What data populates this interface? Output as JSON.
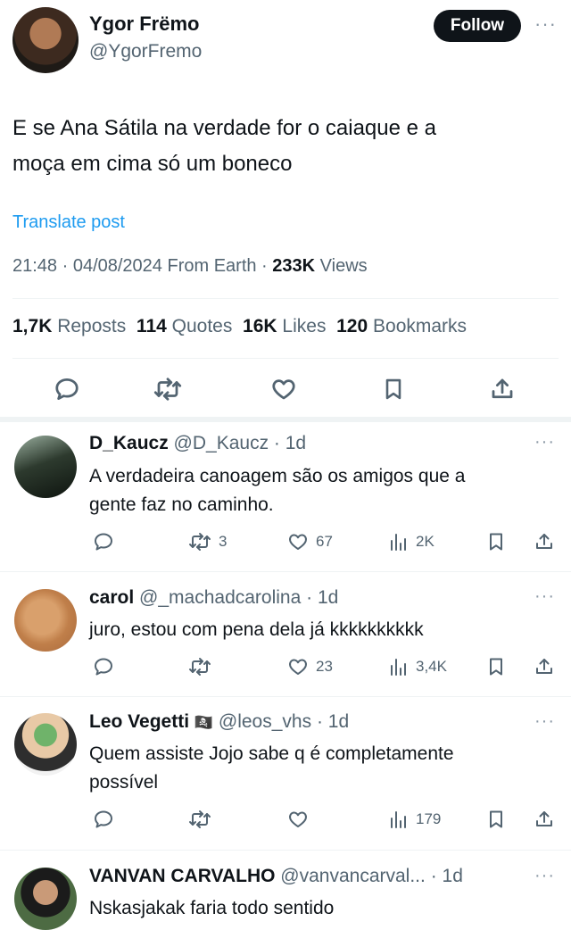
{
  "post": {
    "author_name": "Ygor Frëmo",
    "author_handle": "@YgorFremo",
    "follow_label": "Follow",
    "text_line1": "E se Ana Sátila na verdade for o caiaque e a",
    "text_line2": "moça em cima só um boneco",
    "translate_label": "Translate post",
    "timestamp": "21:48 · 04/08/2024 From Earth · ",
    "views_count": "233K",
    "views_label": " Views",
    "stats": {
      "reposts_count": "1,7K",
      "reposts_label": "Reposts",
      "quotes_count": "114",
      "quotes_label": "Quotes",
      "likes_count": "16K",
      "likes_label": "Likes",
      "bookmarks_count": "120",
      "bookmarks_label": "Bookmarks"
    }
  },
  "replies": [
    {
      "name": "D_Kaucz",
      "handle": "@D_Kaucz",
      "time": "· 1d",
      "text_line1": "A verdadeira canoagem são os amigos que a",
      "text_line2": "gente faz no caminho.",
      "reposts": "3",
      "likes": "67",
      "views": "2K"
    },
    {
      "name": "carol",
      "handle": "@_machadcarolina",
      "time": "· 1d",
      "text_line1": "juro, estou com pena dela já kkkkkkkkkk",
      "reposts": "",
      "likes": "23",
      "views": "3,4K"
    },
    {
      "name": "Leo Vegetti",
      "flag_emoji": "🏴‍☠️",
      "handle": "@leos_vhs",
      "time": "· 1d",
      "text_line1": "Quem assiste Jojo sabe q é completamente",
      "text_line2": "possível",
      "reposts": "",
      "likes": "",
      "views": "179"
    },
    {
      "name": "VANVAN CARVALHO",
      "handle": "@vanvancarval...",
      "time": "· 1d",
      "text_line1": "Nskasjakak faria todo sentido"
    }
  ],
  "colors": {
    "link": "#1d9bf0",
    "muted": "#536471",
    "divider": "#eff3f4",
    "text": "#0f1419"
  }
}
